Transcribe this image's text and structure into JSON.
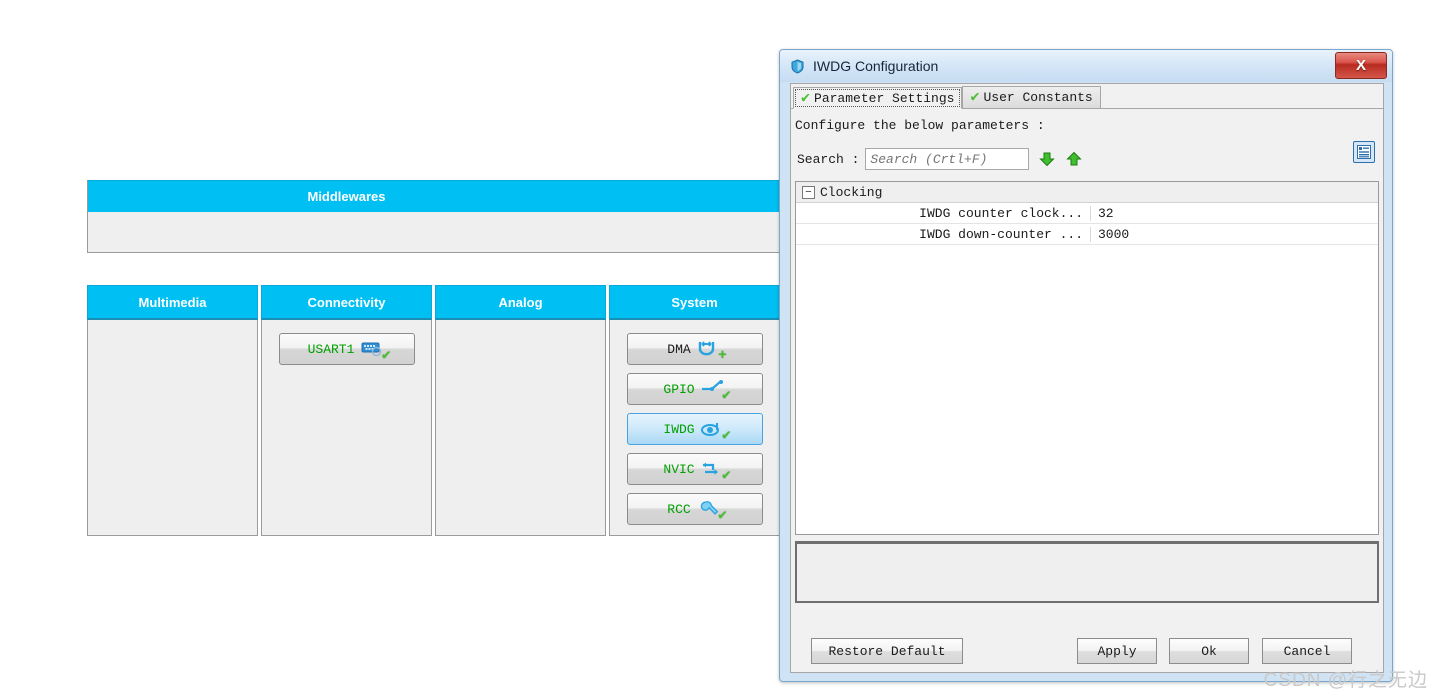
{
  "ide": {
    "middlewares": {
      "title": "Middlewares"
    },
    "columns": [
      {
        "title": "Multimedia",
        "items": []
      },
      {
        "title": "Connectivity",
        "items": [
          {
            "label": "USART1",
            "icon": "connector-icon",
            "state": "configured",
            "selected": false
          }
        ]
      },
      {
        "title": "Analog",
        "items": []
      },
      {
        "title": "System",
        "items": [
          {
            "label": "DMA",
            "icon": "dma-icon",
            "state": "add",
            "selected": false
          },
          {
            "label": "GPIO",
            "icon": "gpio-icon",
            "state": "configured",
            "selected": false
          },
          {
            "label": "IWDG",
            "icon": "iwdg-icon",
            "state": "configured",
            "selected": true
          },
          {
            "label": "NVIC",
            "icon": "nvic-icon",
            "state": "configured",
            "selected": false
          },
          {
            "label": "RCC",
            "icon": "rcc-icon",
            "state": "configured",
            "selected": false
          }
        ]
      }
    ]
  },
  "dialog": {
    "title": "IWDG Configuration",
    "close_label": "X",
    "tabs": [
      {
        "label": "Parameter Settings",
        "active": true
      },
      {
        "label": "User Constants",
        "active": false
      }
    ],
    "instruction": "Configure the below parameters :",
    "search": {
      "label": "Search :",
      "value": "",
      "placeholder": "Search (Crtl+F)"
    },
    "table": {
      "groups": [
        {
          "name": "Clocking",
          "expanded": true,
          "rows": [
            {
              "name": "IWDG counter clock...",
              "value": "32"
            },
            {
              "name": "IWDG down-counter ...",
              "value": "3000"
            }
          ]
        }
      ]
    },
    "description": "",
    "buttons": {
      "restore": "Restore Default",
      "apply": "Apply",
      "ok": "Ok",
      "cancel": "Cancel"
    }
  },
  "watermark": "CSDN @行之无边",
  "colors": {
    "header_cyan": "#00BFF3",
    "green_text": "#00A000",
    "check_green": "#4CBE34",
    "close_red": "#B72A20",
    "selected_blue": "#A9D8F5"
  }
}
